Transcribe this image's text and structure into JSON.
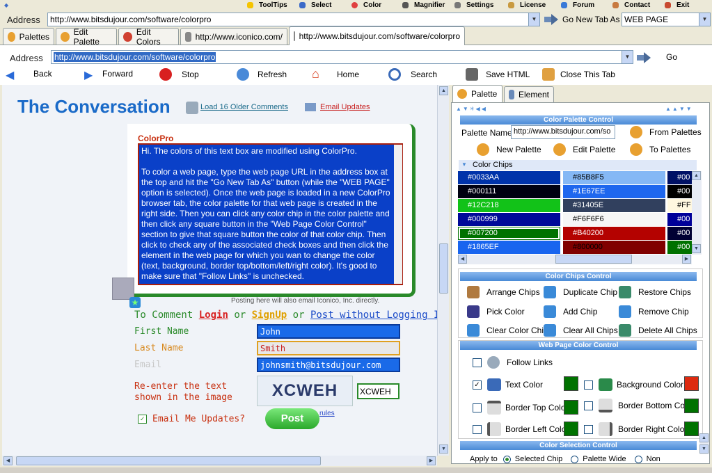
{
  "menu": [
    {
      "label": "ToolTips",
      "icon": "tooltips-icon",
      "color": "#f5c400"
    },
    {
      "label": "Select",
      "icon": "select-icon",
      "color": "#3b6ac8"
    },
    {
      "label": "Color",
      "icon": "color-icon",
      "color": "#e04040"
    },
    {
      "label": "Magnifier",
      "icon": "magnifier-icon",
      "color": "#555"
    },
    {
      "label": "Settings",
      "icon": "settings-icon",
      "color": "#777"
    },
    {
      "label": "License",
      "icon": "license-icon",
      "color": "#c99a40"
    },
    {
      "label": "Forum",
      "icon": "forum-icon",
      "color": "#3a7ad8"
    },
    {
      "label": "Contact",
      "icon": "contact-icon",
      "color": "#c87a40"
    },
    {
      "label": "Exit",
      "icon": "exit-icon",
      "color": "#c84a30"
    }
  ],
  "address_label": "Address",
  "address_url": "http://www.bitsdujour.com/software/colorpro",
  "go_new_tab_label": "Go New Tab As",
  "go_new_tab_option": "WEB PAGE",
  "tabs": [
    {
      "label": "Palettes",
      "icon": "palette-icon"
    },
    {
      "label": "Edit Palette",
      "icon": "edit-palette-icon"
    },
    {
      "label": "Edit Colors",
      "icon": "edit-colors-icon"
    },
    {
      "label": "http://www.iconico.com/",
      "icon": "browser-icon"
    },
    {
      "label": "http://www.bitsdujour.com/software/colorpro",
      "icon": "browser-icon"
    }
  ],
  "inner_address_label": "Address",
  "inner_address_url": "http://www.bitsdujour.com/software/colorpro",
  "go_label": "Go",
  "nav": [
    {
      "label": "Back",
      "icon": "back-arrow-icon"
    },
    {
      "label": "Forward",
      "icon": "forward-arrow-icon"
    },
    {
      "label": "Stop",
      "icon": "stop-icon"
    },
    {
      "label": "Refresh",
      "icon": "refresh-icon"
    },
    {
      "label": "Home",
      "icon": "home-icon"
    },
    {
      "label": "Search",
      "icon": "search-icon"
    },
    {
      "label": "Save HTML",
      "icon": "save-icon"
    },
    {
      "label": "Close This Tab",
      "icon": "close-tab-icon"
    }
  ],
  "page": {
    "title": "The Conversation",
    "load_older": "Load 16 Older Comments",
    "email_updates_link": "Email Updates",
    "comment_author": "ColorPro",
    "comment_text": "Hi. The colors of this text box are modified using ColorPro.\n\nTo color a web page, type the web page URL in the address box at the top and hit the \"Go New Tab As\" button (while the \"WEB PAGE\" option is selected). Once the web page is loaded in a new ColorPro browser tab, the color palette for that web page is created in the right side. Then you can click any color chip in the color palette and then click any square button in the \"Web Page Color Control\" section to give that square button the color of that color chip. Then click to check any of the associated check boxes and then click the element in the web page for which you wan to change the color (text, background, border top/bottom/left/right color). It's good to make sure that \"Follow Links\" is unchecked.",
    "posting_note": "Posting here will also email Iconico, Inc. directly.",
    "to_comment": "To Comment",
    "login": "Login",
    "or1": "or",
    "signup": "SignUp",
    "or2": "or",
    "post_without": "Post without Logging In",
    "first_name_label": "First Name",
    "first_name_value": "John",
    "last_name_label": "Last Name",
    "last_name_value": "Smith",
    "email_label": "Email",
    "email_value": "johnsmith@bitsdujour.com",
    "captcha_label": "Re-enter the text shown in the image",
    "captcha_image_text": "XCWEH",
    "captcha_value": "XCWEH",
    "email_me_label": "Email Me Updates?",
    "post_button": "Post",
    "rules_link": "rules"
  },
  "right": {
    "tabs": [
      "Palette",
      "Element"
    ],
    "palette_control_title": "Color Palette Control",
    "palette_name_label": "Palette Name",
    "palette_name_value": "http://www.bitsdujour.com/so",
    "from_palettes": "From Palettes",
    "new_palette": "New Palette",
    "edit_palette": "Edit Palette",
    "to_palettes": "To Palettes",
    "color_chips_label": "Color Chips",
    "chips": [
      [
        "#0033AA",
        "#85B8F5",
        "#00"
      ],
      [
        "#000111",
        "#1E67EE",
        "#00"
      ],
      [
        "#12C218",
        "#31405E",
        "#FF"
      ],
      [
        "#000999",
        "#F6F6F6",
        "#00"
      ],
      [
        "#007200",
        "#B40200",
        "#00"
      ],
      [
        "#1865EF",
        "#800000",
        "#00"
      ]
    ],
    "chip_colors": [
      [
        "#0033aa",
        "#85b8f5",
        "#001166"
      ],
      [
        "#000111",
        "#1e67ee",
        "#000000"
      ],
      [
        "#12c218",
        "#31405e",
        "#fff8e0"
      ],
      [
        "#000999",
        "#f6f6f6",
        "#000099"
      ],
      [
        "#007200",
        "#b40200",
        "#000033"
      ],
      [
        "#1865ef",
        "#800000",
        "#007200"
      ]
    ],
    "chips_control_title": "Color Chips Control",
    "chips_controls": [
      "Arrange Chips",
      "Duplicate Chip",
      "Restore Chips",
      "Pick Color",
      "Add Chip",
      "Remove Chip",
      "Clear Color Chip",
      "Clear All Chips",
      "Delete All Chips"
    ],
    "web_control_title": "Web Page Color Control",
    "follow_links": "Follow Links",
    "text_color": "Text Color",
    "background_color": "Background Color",
    "border_top_color": "Border Top Color",
    "border_bottom_color": "Border Bottom Color",
    "border_left_color": "Border Left Color",
    "border_right_color": "Border Right Color",
    "swatches": {
      "text": "#007200",
      "background": "#dd2a10",
      "border_top": "#007200",
      "border_bottom": "#007200",
      "border_left": "#007200",
      "border_right": "#007200"
    },
    "selection_title": "Color Selection Control",
    "apply_to": "Apply to",
    "selected_chip": "Selected Chip",
    "palette_wide": "Palette Wide",
    "none": "Non"
  }
}
